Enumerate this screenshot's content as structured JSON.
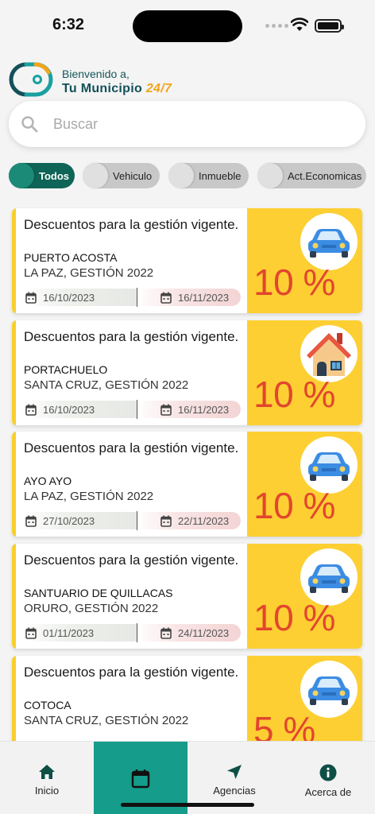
{
  "status_bar": {
    "time": "6:32"
  },
  "header": {
    "welcome": "Bienvenido a,",
    "brand_name": "Tu Municipio",
    "brand_suffix": "24/7",
    "colors": {
      "brand": "#14505a",
      "accent": "#f0a51c"
    }
  },
  "search": {
    "placeholder": "Buscar",
    "value": ""
  },
  "filters": [
    {
      "label": "Todos",
      "active": true
    },
    {
      "label": "Vehiculo",
      "active": false
    },
    {
      "label": "Inmueble",
      "active": false
    },
    {
      "label": "Act.Economicas",
      "active": false
    }
  ],
  "cards": [
    {
      "title": "Descuentos para la gestión vigente.",
      "place": "PUERTO ACOSTA",
      "region": "LA PAZ, GESTIÓN 2022",
      "start": "16/10/2023",
      "end": "16/11/2023",
      "discount": "10 %",
      "icon": "car-icon"
    },
    {
      "title": "Descuentos para la gestión vigente.",
      "place": "PORTACHUELO",
      "region": "SANTA CRUZ, GESTIÓN 2022",
      "start": "16/10/2023",
      "end": "16/11/2023",
      "discount": "10 %",
      "icon": "house-icon"
    },
    {
      "title": "Descuentos para la gestión vigente.",
      "place": "AYO AYO",
      "region": "LA PAZ, GESTIÓN 2022",
      "start": "27/10/2023",
      "end": "22/11/2023",
      "discount": "10 %",
      "icon": "car-icon"
    },
    {
      "title": "Descuentos para la gestión vigente.",
      "place": "SANTUARIO DE QUILLACAS",
      "region": "ORURO, GESTIÓN 2022",
      "start": "01/11/2023",
      "end": "24/11/2023",
      "discount": "10 %",
      "icon": "car-icon"
    },
    {
      "title": "Descuentos para la gestión vigente.",
      "place": "COTOCA",
      "region": "SANTA CRUZ, GESTIÓN 2022",
      "start": "",
      "end": "",
      "discount": "5 %",
      "icon": "car-icon"
    }
  ],
  "nav": [
    {
      "label": "Inicio",
      "icon": "home-icon"
    },
    {
      "label": "",
      "icon": "calendar-icon",
      "active": true
    },
    {
      "label": "Agencias",
      "icon": "navigation-arrow-icon"
    },
    {
      "label": "Acerca de",
      "icon": "info-icon"
    }
  ],
  "colors": {
    "primary": "#0e6457",
    "nav_active": "#169c8a",
    "discount_bg": "#fdcf32",
    "discount_text": "#e2462e"
  }
}
